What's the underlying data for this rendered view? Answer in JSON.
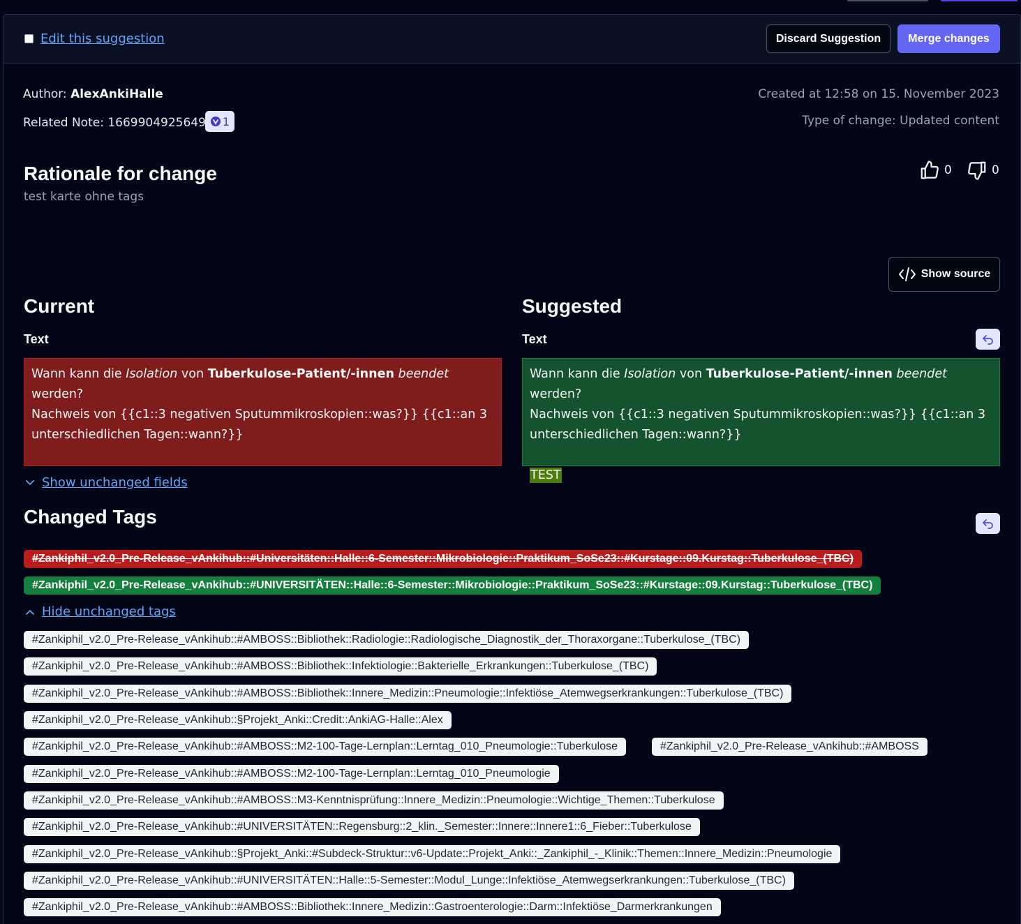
{
  "header": {
    "edit_label": "Edit this suggestion",
    "discard_label": "Discard Suggestion",
    "merge_label": "Merge changes"
  },
  "meta": {
    "author_label": "Author:",
    "author": "AlexAnkiHalle",
    "related_note_label": "Related Note:",
    "related_note_id": "1669904925649",
    "badge_count": "1",
    "created": "Created at 12:58 on 15. November 2023",
    "type_of_change": "Type of change: Updated content"
  },
  "rationale": {
    "title": "Rationale for change",
    "text": "test karte ohne tags",
    "upvotes": "0",
    "downvotes": "0"
  },
  "show_source_label": "Show source",
  "diff": {
    "current_title": "Current",
    "suggested_title": "Suggested",
    "field_name": "Text",
    "current": {
      "p1": "Wann kann die ",
      "i1": "Isolation",
      "p2": " von ",
      "b1": "Tuberkulose-Patient/-innen",
      "p3": " ",
      "i2": "beendet",
      "p4": " werden?",
      "line2": "Nachweis von {{c1::3 negativen Sputummikroskopien::was?}} {{c1::an 3 unterschiedlichen Tagen::wann?}}"
    },
    "suggested": {
      "p1": "Wann kann die ",
      "i1": "Isolation",
      "p2": " von ",
      "b1": "Tuberkulose-Patient/-innen",
      "p3": " ",
      "i2": "beendet",
      "p4": " werden?",
      "line2": "Nachweis von {{c1::3 negativen Sputummikroskopien::was?}} {{c1::an 3 unterschiedlichen Tagen::wann?}}",
      "added": "TEST"
    },
    "show_unchanged_label": "Show unchanged fields"
  },
  "tags": {
    "title": "Changed Tags",
    "removed": "#Zankiphil_v2.0_Pre-Release_vAnkihub::#Universitäten::Halle::6-Semester::Mikrobiologie::Praktikum_SoSe23::#Kurstage::09.Kurstag::Tuberkulose_(TBC)",
    "added": "#Zankiphil_v2.0_Pre-Release_vAnkihub::#UNIVERSITÄTEN::Halle::6-Semester::Mikrobiologie::Praktikum_SoSe23::#Kurstage::09.Kurstag::Tuberkulose_(TBC)",
    "hide_unchanged_label": "Hide unchanged tags",
    "unchanged": [
      "#Zankiphil_v2.0_Pre-Release_vAnkihub::#AMBOSS::Bibliothek::Radiologie::Radiologische_Diagnostik_der_Thoraxorgane::Tuberkulose_(TBC)",
      "#Zankiphil_v2.0_Pre-Release_vAnkihub::#AMBOSS::Bibliothek::Infektiologie::Bakterielle_Erkrankungen::Tuberkulose_(TBC)",
      "#Zankiphil_v2.0_Pre-Release_vAnkihub::#AMBOSS::Bibliothek::Innere_Medizin::Pneumologie::Infektiöse_Atemwegserkrankungen::Tuberkulose_(TBC)",
      "#Zankiphil_v2.0_Pre-Release_vAnkihub::§Projekt_Anki::Credit::AnkiAG-Halle::Alex",
      "#Zankiphil_v2.0_Pre-Release_vAnkihub::#AMBOSS::M2-100-Tage-Lernplan::Lerntag_010_Pneumologie::Tuberkulose",
      "#Zankiphil_v2.0_Pre-Release_vAnkihub::#AMBOSS",
      "#Zankiphil_v2.0_Pre-Release_vAnkihub::#AMBOSS::M2-100-Tage-Lernplan::Lerntag_010_Pneumologie",
      "#Zankiphil_v2.0_Pre-Release_vAnkihub::#AMBOSS::M3-Kenntnisprüfung::Innere_Medizin::Pneumologie::Wichtige_Themen::Tuberkulose",
      "#Zankiphil_v2.0_Pre-Release_vAnkihub::#UNIVERSITÄTEN::Regensburg::2_klin._Semester::Innere::Innere1::6_Fieber::Tuberkulose",
      "#Zankiphil_v2.0_Pre-Release_vAnkihub::§Projekt_Anki::#Subdeck-Struktur::v6-Update::Projekt_Anki::_Zankiphil_-_Klinik::Themen::Innere_Medizin::Pneumologie",
      "#Zankiphil_v2.0_Pre-Release_vAnkihub::#UNIVERSITÄTEN::Halle::5-Semester::Modul_Lunge::Infektiöse_Atemwegserkrankungen::Tuberkulose_(TBC)",
      "#Zankiphil_v2.0_Pre-Release_vAnkihub::#AMBOSS::Bibliothek::Innere_Medizin::Gastroenterologie::Darm::Infektiöse_Darmerkrankungen"
    ]
  }
}
